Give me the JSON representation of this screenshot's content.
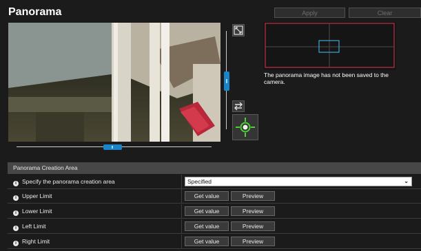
{
  "page": {
    "title": "Panorama"
  },
  "toolbar": {
    "apply_label": "Apply",
    "clear_label": "Clear"
  },
  "panorama": {
    "message": "The panorama image has not been saved to the camera."
  },
  "section": {
    "header": "Panorama Creation Area",
    "rows": [
      {
        "label": "Specify the panorama creation area",
        "select_value": "Specified"
      },
      {
        "label": "Upper Limit",
        "get_label": "Get value",
        "preview_label": "Preview"
      },
      {
        "label": "Lower Limit",
        "get_label": "Get value",
        "preview_label": "Preview"
      },
      {
        "label": "Left Limit",
        "get_label": "Get value",
        "preview_label": "Preview"
      },
      {
        "label": "Right Limit",
        "get_label": "Get value",
        "preview_label": "Preview"
      }
    ]
  },
  "icons": {
    "info": "info-icon",
    "fit": "fit-icon",
    "swap": "swap-arrows-icon",
    "center": "crosshair-icon",
    "select": "chevron-down-icon"
  },
  "colors": {
    "accent": "#1a84c9",
    "crosshair": "#4cd137",
    "pano_frame": "#c0304a",
    "pano_window": "#3fa7d6"
  }
}
